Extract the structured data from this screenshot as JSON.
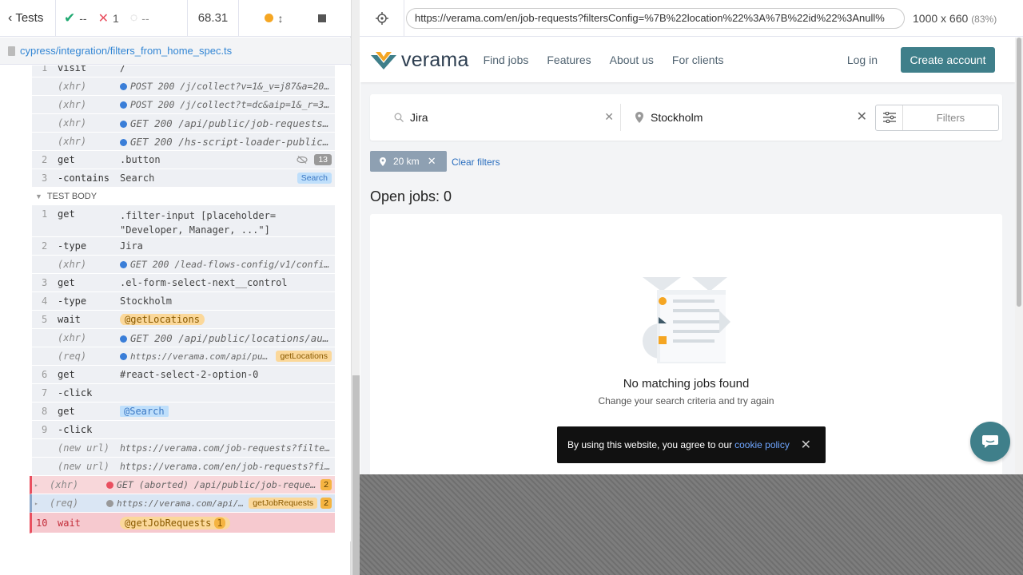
{
  "runner": {
    "tests_label": "Tests",
    "passed": "--",
    "failed": "1",
    "pending": "--",
    "duration": "68.31",
    "spec_path": "cypress/integration/filters_from_home_spec.ts"
  },
  "commands_before": [
    {
      "num": "1",
      "name": "visit",
      "msg": "/"
    },
    {
      "num": "",
      "name": "(xhr)",
      "msg": "POST 200 /j/collect?v=1&_v=j87&a=201576..."
    },
    {
      "num": "",
      "name": "(xhr)",
      "msg": "POST 200 /j/collect?t=dc&aip=1&_r=3&v=1..."
    },
    {
      "num": "",
      "name": "(xhr)",
      "msg": "GET 200 /api/public/job-requests?..."
    },
    {
      "num": "",
      "name": "(xhr)",
      "msg": "GET 200 /hs-script-loader-public/..."
    }
  ],
  "cmd_get_button": {
    "num": "2",
    "name": "get",
    "msg": ".button",
    "count": "13"
  },
  "cmd_contains": {
    "num": "3",
    "name": "-contains",
    "msg": "Search",
    "badge": "Search"
  },
  "test_body_label": "TEST BODY",
  "body": {
    "c1": {
      "num": "1",
      "name": "get",
      "msg": ".filter-input [placeholder= \"Developer, Manager, ...\"]"
    },
    "c2": {
      "num": "2",
      "name": "-type",
      "msg": "Jira"
    },
    "c2x": {
      "name": "(xhr)",
      "msg": "GET 200 /lead-flows-config/v1/config/js..."
    },
    "c3": {
      "num": "3",
      "name": "get",
      "msg": ".el-form-select-next__control"
    },
    "c4": {
      "num": "4",
      "name": "-type",
      "msg": "Stockholm"
    },
    "c5": {
      "num": "5",
      "name": "wait",
      "msg": "@getLocations"
    },
    "c5x": {
      "name": "(xhr)",
      "msg": "GET 200 /api/public/locations/aut..."
    },
    "c5r": {
      "name": "(req)",
      "msg": "https://verama.com/api/publi...",
      "badge": "getLocations"
    },
    "c6": {
      "num": "6",
      "name": "get",
      "msg": "#react-select-2-option-0"
    },
    "c7": {
      "num": "7",
      "name": "-click",
      "msg": ""
    },
    "c8": {
      "num": "8",
      "name": "get",
      "msg": "@Search"
    },
    "c9": {
      "num": "9",
      "name": "-click",
      "msg": ""
    },
    "u1": {
      "name": "(new url)",
      "msg": "https://verama.com/job-requests?filtersCo..."
    },
    "u2": {
      "name": "(new url)",
      "msg": "https://verama.com/en/job-requests?filter..."
    },
    "xa": {
      "name": "(xhr)",
      "msg": "GET (aborted) /api/public/job-requests?...",
      "count": "2"
    },
    "rq": {
      "name": "(req)",
      "msg": "https://verama.com/api/pub...",
      "badge": "getJobRequests",
      "count": "2"
    },
    "c10": {
      "num": "10",
      "name": "wait",
      "msg": "@getJobRequests",
      "count": "1"
    }
  },
  "aut": {
    "url": "https://verama.com/en/job-requests?filtersConfig=%7B%22location%22%3A%7B%22id%22%3Anull%",
    "viewport": "1000 x 660",
    "zoom": "(83%)"
  },
  "site": {
    "logo": "verama",
    "nav": [
      "Find jobs",
      "Features",
      "About us",
      "For clients"
    ],
    "login": "Log in",
    "create": "Create account",
    "keyword": "Jira",
    "location": "Stockholm",
    "filters": "Filters",
    "chip": "20 km",
    "clear": "Clear filters",
    "open_jobs": "Open jobs: 0",
    "empty_title": "No matching jobs found",
    "empty_sub": "Change your search criteria and try again",
    "cookie_text": "By using this website, you agree to our",
    "cookie_link": "cookie policy"
  },
  "colors": {
    "brand": "#3f7f8a",
    "fail": "#e94f5f",
    "pass": "#1fa971",
    "accent": "#f5a623"
  }
}
